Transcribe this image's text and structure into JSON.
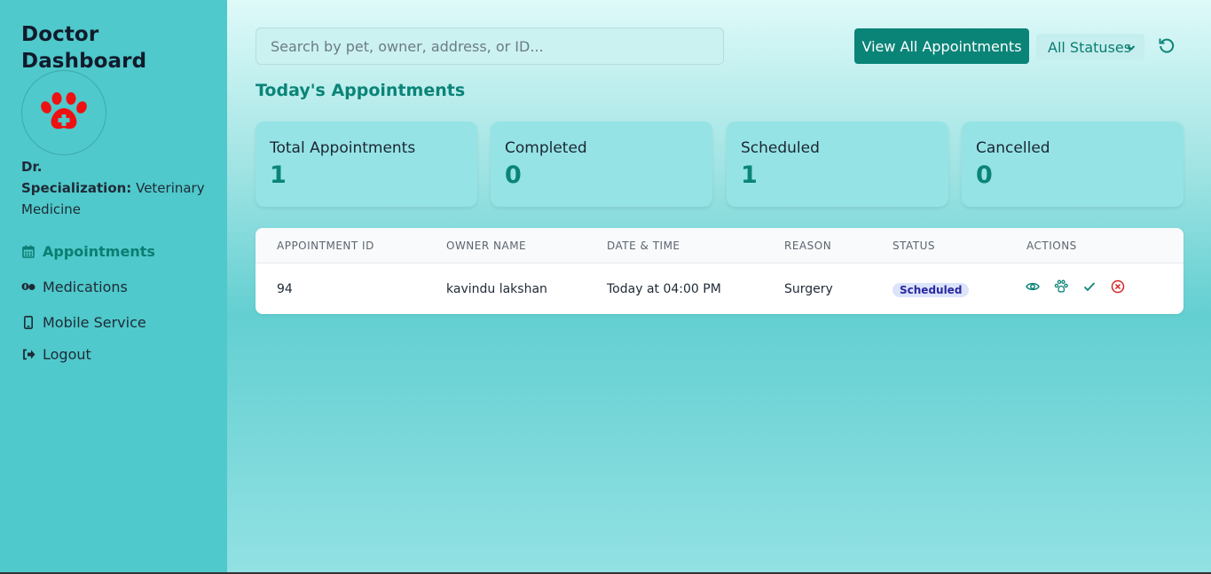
{
  "sidebar": {
    "title": "Doctor Dashboard",
    "doctor_prefix": "Dr.",
    "specialization_label": "Specialization:",
    "specialization_value": "Veterinary Medicine",
    "nav": [
      {
        "label": "Appointments",
        "icon": "calendar-icon",
        "active": true
      },
      {
        "label": "Medications",
        "icon": "pills-icon",
        "active": false
      },
      {
        "label": "Mobile Service",
        "icon": "mobile-icon",
        "active": false
      },
      {
        "label": "Logout",
        "icon": "logout-icon",
        "active": false
      }
    ]
  },
  "header": {
    "search_placeholder": "Search by pet, owner, address, or ID...",
    "view_all_label": "View All Appointments",
    "status_filter": "All Statuses"
  },
  "section_title": "Today's Appointments",
  "stats": [
    {
      "label": "Total Appointments",
      "value": "1"
    },
    {
      "label": "Completed",
      "value": "0"
    },
    {
      "label": "Scheduled",
      "value": "1"
    },
    {
      "label": "Cancelled",
      "value": "0"
    }
  ],
  "table": {
    "headers": [
      "APPOINTMENT ID",
      "OWNER NAME",
      "DATE & TIME",
      "REASON",
      "STATUS",
      "ACTIONS"
    ],
    "rows": [
      {
        "id": "94",
        "owner": "kavindu lakshan",
        "datetime": "Today at 04:00 PM",
        "reason": "Surgery",
        "status": "Scheduled"
      }
    ]
  },
  "colors": {
    "sidebar_bg": "#4fc9cb",
    "accent": "#0b8478",
    "danger": "#d42525",
    "paw": "#ee1111"
  }
}
